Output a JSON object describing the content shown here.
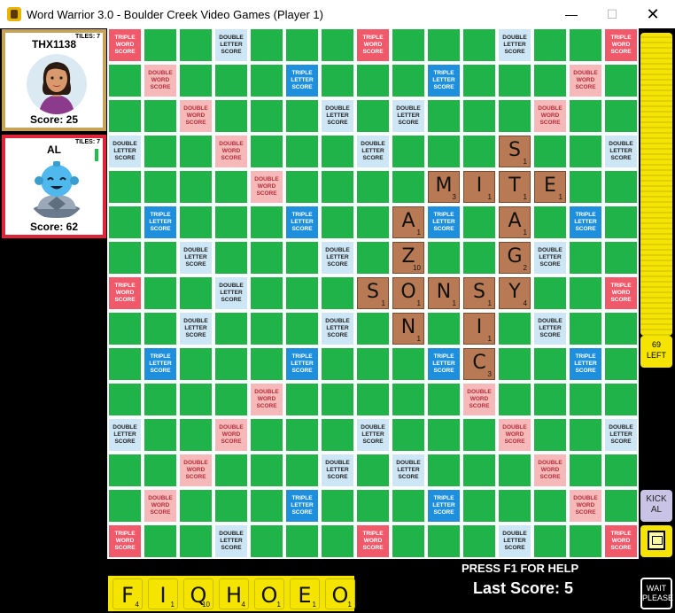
{
  "window": {
    "title": "Word Warrior 3.0 - Boulder Creek Video Games (Player 1)",
    "minimize": "—",
    "maximize": "☐",
    "close": "✕"
  },
  "players": [
    {
      "name": "THX1138",
      "tiles_label": "TILES: 7",
      "score_label": "Score: 25",
      "border_color": "#c7a35a",
      "avatar": "woman-avatar-icon"
    },
    {
      "name": "AL",
      "tiles_label": "TILES: 7",
      "score_label": "Score: 62",
      "border_color": "#e0243a",
      "avatar": "robot-avatar-icon"
    }
  ],
  "bonus_labels": {
    "tw": [
      "TRIPLE",
      "WORD",
      "SCORE"
    ],
    "dw": [
      "DOUBLE",
      "WORD",
      "SCORE"
    ],
    "tl": [
      "TRIPLE",
      "LETTER",
      "SCORE"
    ],
    "dl": [
      "DOUBLE",
      "LETTER",
      "SCORE"
    ]
  },
  "board_bonus_rows": [
    "T..d...T...d..T",
    ".D...t...t...D.",
    "..D...d.d...D..",
    "d..D...d...D..d",
    "....D.....D....",
    ".t...t...t...t.",
    "..d...d.d...d..",
    "T..d.......d..T",
    "..d...d.d...d..",
    ".t...t...t...t.",
    "....D.....D....",
    "d..D...d...D..d",
    "..D...d.d...D..",
    ".D...t...t...D.",
    "T..d...T...d..T"
  ],
  "placed_tiles": [
    {
      "row": 3,
      "col": 11,
      "letter": "S",
      "points": "1"
    },
    {
      "row": 4,
      "col": 9,
      "letter": "M",
      "points": "3"
    },
    {
      "row": 4,
      "col": 10,
      "letter": "I",
      "points": "1"
    },
    {
      "row": 4,
      "col": 11,
      "letter": "T",
      "points": "1"
    },
    {
      "row": 4,
      "col": 12,
      "letter": "E",
      "points": "1"
    },
    {
      "row": 5,
      "col": 8,
      "letter": "A",
      "points": "1"
    },
    {
      "row": 5,
      "col": 11,
      "letter": "A",
      "points": "1"
    },
    {
      "row": 6,
      "col": 8,
      "letter": "Z",
      "points": "10"
    },
    {
      "row": 6,
      "col": 11,
      "letter": "G",
      "points": "2"
    },
    {
      "row": 7,
      "col": 7,
      "letter": "S",
      "points": "1"
    },
    {
      "row": 7,
      "col": 8,
      "letter": "O",
      "points": "1"
    },
    {
      "row": 7,
      "col": 9,
      "letter": "N",
      "points": "1"
    },
    {
      "row": 7,
      "col": 10,
      "letter": "S",
      "points": "1"
    },
    {
      "row": 7,
      "col": 11,
      "letter": "Y",
      "points": "4"
    },
    {
      "row": 8,
      "col": 8,
      "letter": "N",
      "points": "1"
    },
    {
      "row": 8,
      "col": 10,
      "letter": "I",
      "points": "1"
    },
    {
      "row": 9,
      "col": 10,
      "letter": "C",
      "points": "3"
    }
  ],
  "tile_bag": {
    "left_count": "69",
    "left_label": "LEFT"
  },
  "kick_button": {
    "line1": "KICK",
    "line2": "AL"
  },
  "help_icon": "help-book-icon",
  "wait_button": {
    "line1": "WAIT",
    "line2": "PLEASE"
  },
  "help_text": "PRESS F1 FOR HELP",
  "last_score": "Last Score: 5",
  "rack": [
    {
      "letter": "F",
      "points": "4"
    },
    {
      "letter": "I",
      "points": "1"
    },
    {
      "letter": "Q",
      "points": "10"
    },
    {
      "letter": "H",
      "points": "4"
    },
    {
      "letter": "O",
      "points": "1"
    },
    {
      "letter": "E",
      "points": "1"
    },
    {
      "letter": "O",
      "points": "1"
    }
  ],
  "colors": {
    "board_green": "#1fb34a",
    "tile_brown": "#b87a55",
    "rack_yellow": "#f4e400",
    "tw": "#f0596a",
    "dw": "#f6b8b8",
    "tl": "#1e8fdc",
    "dl": "#cde6f5"
  }
}
